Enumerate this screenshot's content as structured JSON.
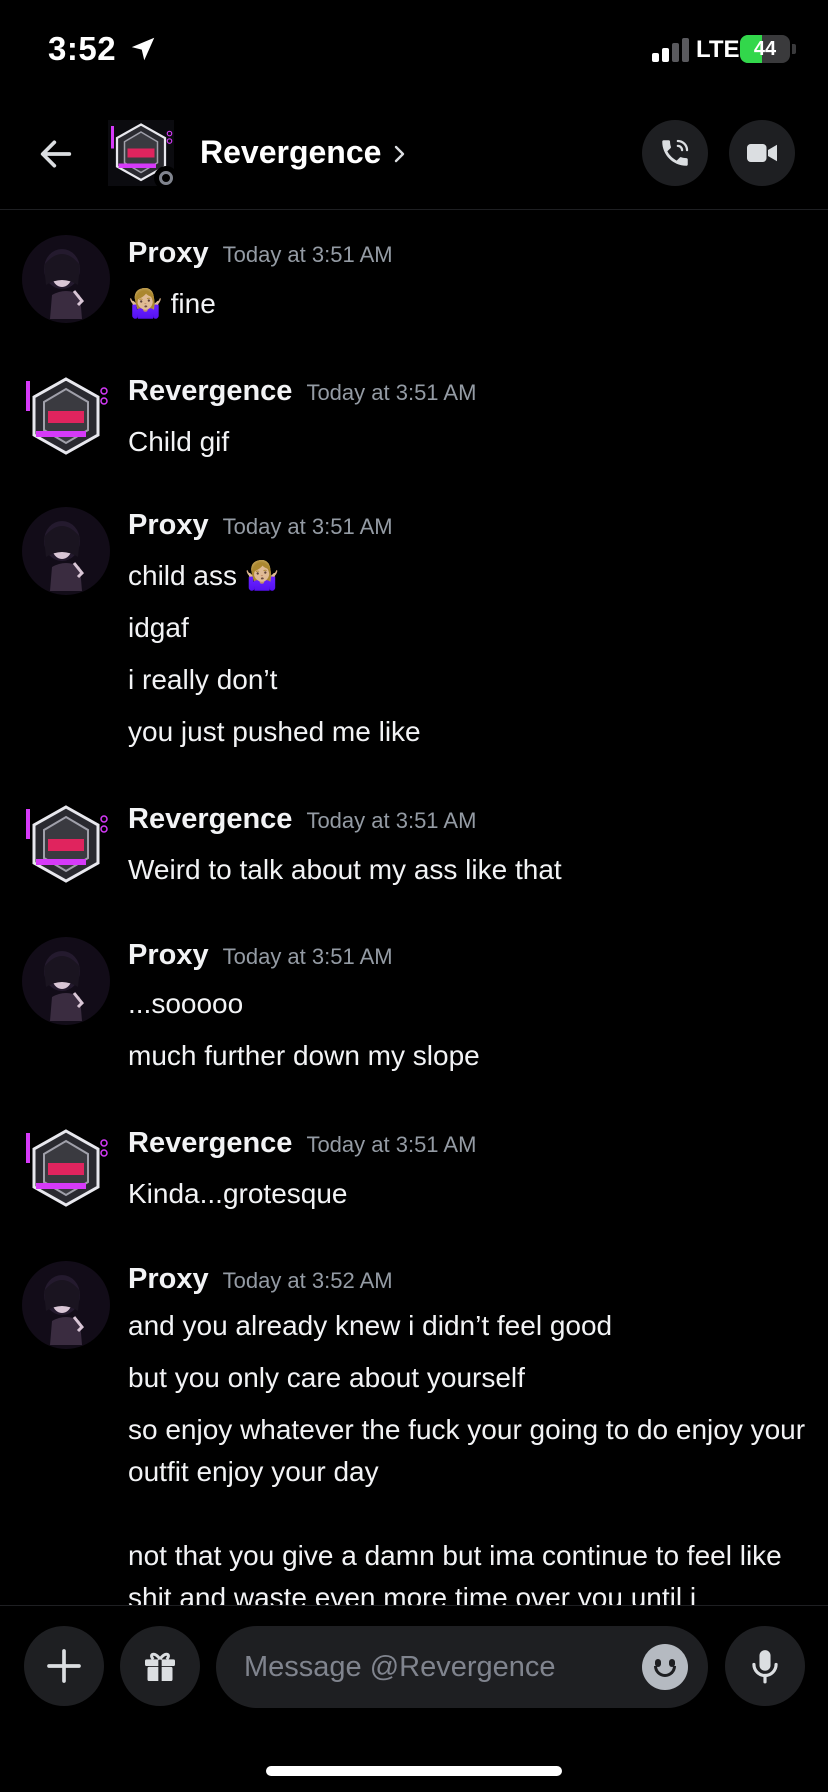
{
  "status_bar": {
    "time": "3:52",
    "network": "LTE",
    "battery_text": "44",
    "battery_level": 0.44,
    "battery_color": "#32d74b"
  },
  "header": {
    "title": "Revergence",
    "back_icon": "arrow-left-icon",
    "call_icon": "phone-call-icon",
    "video_icon": "video-camera-icon"
  },
  "messages": [
    {
      "author": "Proxy",
      "timestamp": "Today at 3:51 AM",
      "avatar": "proxy-avatar",
      "lines": [
        "🤷🏼‍♀️ fine"
      ]
    },
    {
      "author": "Revergence",
      "timestamp": "Today at 3:51 AM",
      "avatar": "revergence-avatar",
      "lines": [
        "Child gif"
      ]
    },
    {
      "author": "Proxy",
      "timestamp": "Today at 3:51 AM",
      "avatar": "proxy-avatar",
      "lines": [
        "child ass 🤷🏼‍♀️",
        "idgaf",
        "i really don’t",
        "you just pushed me like"
      ]
    },
    {
      "author": "Revergence",
      "timestamp": "Today at 3:51 AM",
      "avatar": "revergence-avatar",
      "lines": [
        "Weird to talk about my ass like that"
      ]
    },
    {
      "author": "Proxy",
      "timestamp": "Today at 3:51 AM",
      "avatar": "proxy-avatar",
      "lines": [
        "...sooooo",
        "much further down my slope"
      ]
    },
    {
      "author": "Revergence",
      "timestamp": "Today at 3:51 AM",
      "avatar": "revergence-avatar",
      "lines": [
        "Kinda...grotesque"
      ]
    },
    {
      "author": "Proxy",
      "timestamp": "Today at 3:52 AM",
      "avatar": "proxy-avatar",
      "lines": [
        "and you already knew i didn’t feel good",
        "but you only care about yourself",
        "so enjoy whatever the fuck your going to do enjoy your outfit enjoy your day",
        "not that you give a damn but ima continue to feel like shit and waste even more time over you until i"
      ]
    }
  ],
  "composer": {
    "placeholder": "Message @Revergence",
    "add_icon": "plus-icon",
    "gift_icon": "gift-icon",
    "emoji_icon": "emoji-icon",
    "mic_icon": "microphone-icon"
  }
}
